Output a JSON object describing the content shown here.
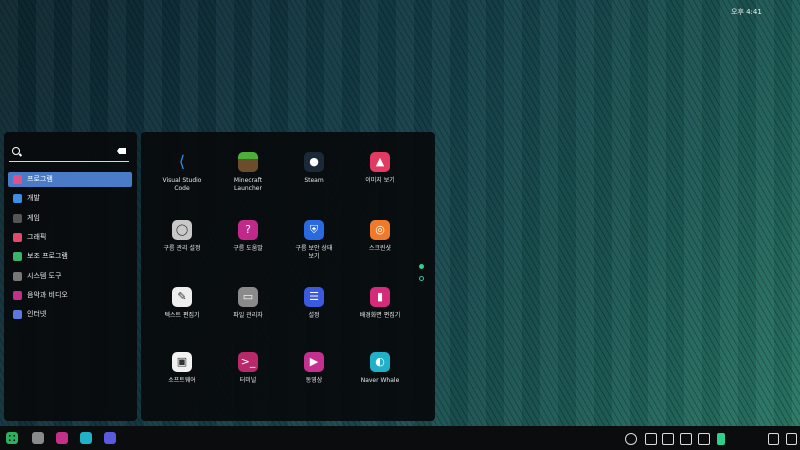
{
  "search": {
    "value": ""
  },
  "categories": [
    {
      "label": "프로그램",
      "icon": "apps-icon",
      "color": "#e0508a",
      "active": true
    },
    {
      "label": "개발",
      "icon": "development-icon",
      "color": "#3a8ee6"
    },
    {
      "label": "게임",
      "icon": "game-icon",
      "color": "#555555"
    },
    {
      "label": "그래픽",
      "icon": "graphics-icon",
      "color": "#e24a6a"
    },
    {
      "label": "보조 프로그램",
      "icon": "accessories-icon",
      "color": "#3cb26a"
    },
    {
      "label": "시스템 도구",
      "icon": "system-tools-icon",
      "color": "#777777"
    },
    {
      "label": "음악과 비디오",
      "icon": "multimedia-icon",
      "color": "#c2308a"
    },
    {
      "label": "인터넷",
      "icon": "internet-icon",
      "color": "#5a7adf"
    }
  ],
  "apps": [
    {
      "label": "Visual Studio\nCode",
      "icon": "vscode-icon",
      "color": "#0a0c0e",
      "glyph": "⟨"
    },
    {
      "label": "Minecraft\nLauncher",
      "icon": "minecraft-icon",
      "color": "#6b4d2c",
      "glyph": ""
    },
    {
      "label": "Steam",
      "icon": "steam-icon",
      "color": "#1b2838",
      "glyph": "●"
    },
    {
      "label": "이미지 보기",
      "icon": "image-viewer-icon",
      "color": "#e23a62",
      "glyph": "▲"
    },
    {
      "label": "구름 관리 설정",
      "icon": "cloud-settings-icon",
      "color": "#c8c8c8",
      "glyph": "◯"
    },
    {
      "label": "구름 도움말",
      "icon": "help-icon",
      "color": "#c0288a",
      "glyph": "?"
    },
    {
      "label": "구름 보안 상태\n보기",
      "icon": "security-shield-icon",
      "color": "#2a6ae0",
      "glyph": "⛨"
    },
    {
      "label": "스크린샷",
      "icon": "screenshot-icon",
      "color": "#f07a2a",
      "glyph": "◎"
    },
    {
      "label": "텍스트 편집기",
      "icon": "text-editor-icon",
      "color": "#eeeeee",
      "glyph": "✎"
    },
    {
      "label": "파일 관리자",
      "icon": "file-manager-icon",
      "color": "#8a8a8a",
      "glyph": "▭"
    },
    {
      "label": "설정",
      "icon": "settings-sliders-icon",
      "color": "#3a5adf",
      "glyph": "☰"
    },
    {
      "label": "배경화면 편집기",
      "icon": "wallpaper-editor-icon",
      "color": "#d62a7a",
      "glyph": "▮"
    },
    {
      "label": "소프트웨어",
      "icon": "software-icon",
      "color": "#f2f2f2",
      "glyph": "▣"
    },
    {
      "label": "터미널",
      "icon": "terminal-icon",
      "color": "#b8286a",
      "glyph": ">_"
    },
    {
      "label": "동영상",
      "icon": "video-player-icon",
      "color": "#c43090",
      "glyph": "▶"
    },
    {
      "label": "Naver Whale",
      "icon": "naver-whale-icon",
      "color": "#20b0c8",
      "glyph": "◐"
    }
  ],
  "taskbar": {
    "apps": [
      {
        "icon": "app-launcher-icon",
        "color": "#2fae5f"
      },
      {
        "icon": "file-manager-icon",
        "color": "#8a8a8a"
      },
      {
        "icon": "multimedia-icon",
        "color": "#c2308a"
      },
      {
        "icon": "naver-whale-icon",
        "color": "#20b0c8"
      },
      {
        "icon": "settings-icon",
        "color": "#5a5adf"
      }
    ],
    "tray": [
      "update-icon",
      "notification-icon",
      "keyboard-icon",
      "toggle-icon",
      "volume-icon",
      "battery-icon"
    ],
    "clock": "오후 4:41"
  }
}
